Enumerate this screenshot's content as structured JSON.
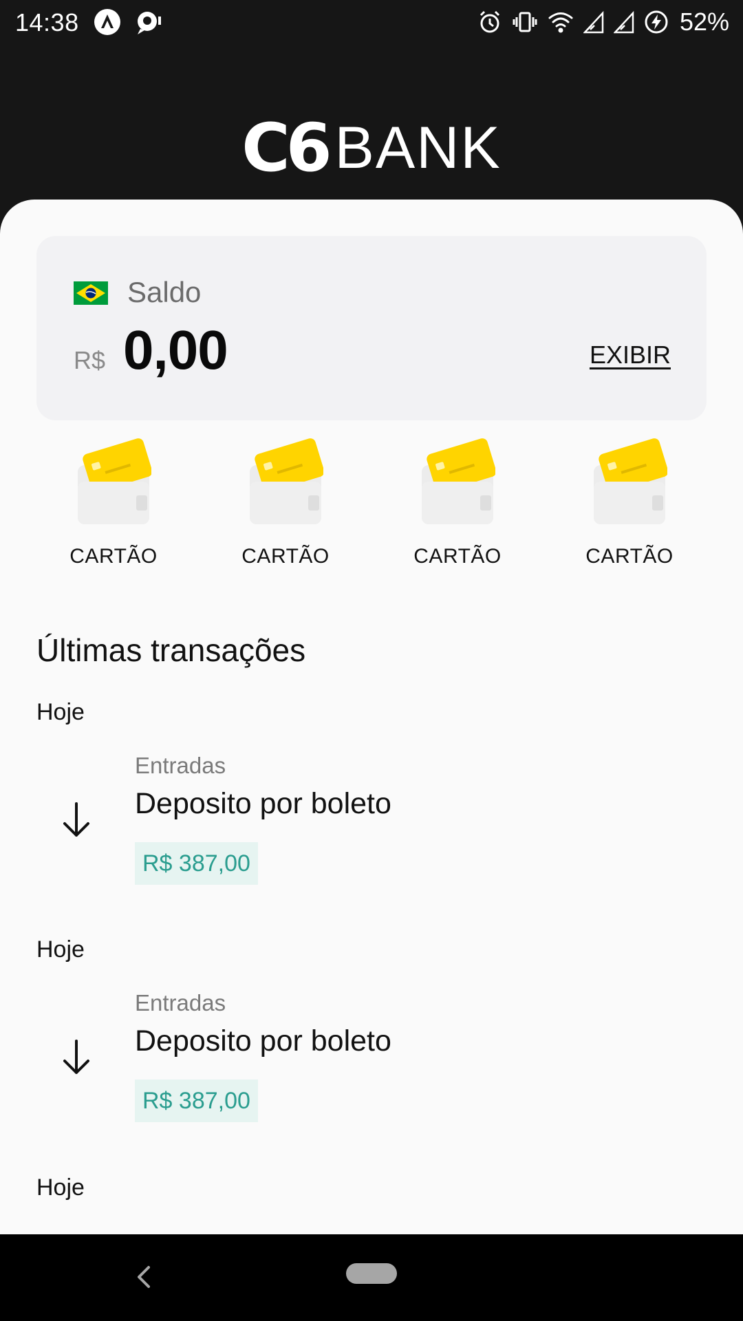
{
  "status_bar": {
    "time": "14:38",
    "left_icons": [
      "app-notification-icon",
      "messenger-notification-icon"
    ],
    "right_icons": [
      "alarm-icon",
      "vibrate-icon",
      "wifi-icon",
      "signal-icon",
      "signal-icon",
      "battery-charging-icon"
    ],
    "battery": "52%"
  },
  "header": {
    "brand_c6": "C6",
    "brand_bank": "BANK"
  },
  "balance": {
    "label": "Saldo",
    "flag": "brazil-flag",
    "currency": "R$",
    "amount": "0,00",
    "show_label": "EXIBIR"
  },
  "cards": [
    {
      "label": "CARTÃO",
      "icon": "wallet-card-icon"
    },
    {
      "label": "CARTÃO",
      "icon": "wallet-card-icon"
    },
    {
      "label": "CARTÃO",
      "icon": "wallet-card-icon"
    },
    {
      "label": "CARTÃO",
      "icon": "wallet-card-icon"
    }
  ],
  "transactions_title": "Últimas transações",
  "transactions": [
    {
      "date": "Hoje",
      "category": "Entradas",
      "title": "Deposito por boleto",
      "amount": "R$ 387,00",
      "icon": "arrow-down-icon"
    },
    {
      "date": "Hoje",
      "category": "Entradas",
      "title": "Deposito por boleto",
      "amount": "R$ 387,00",
      "icon": "arrow-down-icon"
    },
    {
      "date": "Hoje"
    }
  ],
  "colors": {
    "header_bg": "#161616",
    "sheet_bg": "#fafafa",
    "card_bg": "#f2f2f4",
    "accent_yellow": "#ffd400",
    "amount_green": "#2a9d8f",
    "amount_badge_bg": "#e6f4f1"
  }
}
